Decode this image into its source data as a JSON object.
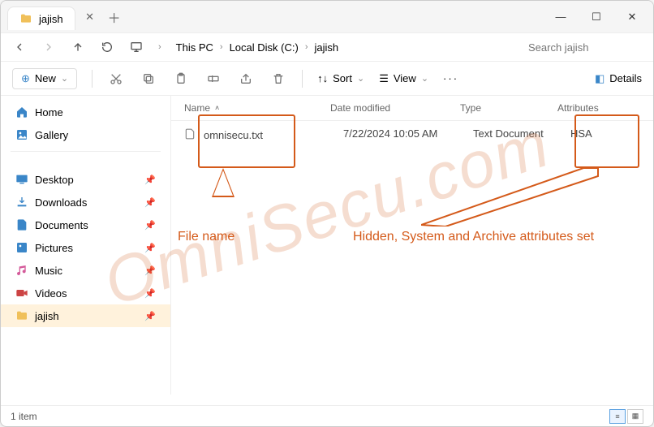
{
  "tab": {
    "title": "jajish"
  },
  "breadcrumb": {
    "p0": "This PC",
    "p1": "Local Disk (C:)",
    "p2": "jajish"
  },
  "search": {
    "placeholder": "Search jajish"
  },
  "toolbar": {
    "new_label": "New",
    "sort_label": "Sort",
    "view_label": "View",
    "details_label": "Details"
  },
  "sidebar": {
    "items": [
      {
        "label": "Home"
      },
      {
        "label": "Gallery"
      },
      {
        "label": "Desktop"
      },
      {
        "label": "Downloads"
      },
      {
        "label": "Documents"
      },
      {
        "label": "Pictures"
      },
      {
        "label": "Music"
      },
      {
        "label": "Videos"
      },
      {
        "label": "jajish"
      }
    ]
  },
  "columns": {
    "name": "Name",
    "date": "Date modified",
    "type": "Type",
    "attr": "Attributes"
  },
  "files": [
    {
      "name": "omnisecu.txt",
      "date": "7/22/2024 10:05 AM",
      "type": "Text Document",
      "attr": "HSA"
    }
  ],
  "status": {
    "count": "1 item"
  },
  "annotations": {
    "file_name_label": "File name",
    "attrs_label": "Hidden, System and Archive attributes set",
    "watermark": "OmniSecu.com"
  }
}
